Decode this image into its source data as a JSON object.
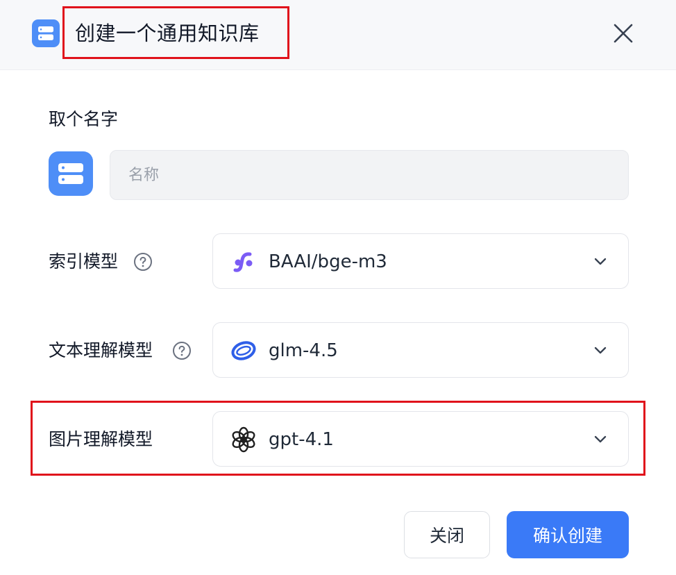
{
  "dialog": {
    "title": "创建一个通用知识库",
    "close_icon": "close-icon",
    "header_icon": "database-icon"
  },
  "name_section": {
    "label": "取个名字",
    "avatar_icon": "database-icon",
    "input_value": "",
    "input_placeholder": "名称"
  },
  "index_model": {
    "label": "索引模型",
    "help_icon": "help-circle-icon",
    "selected": "BAAI/bge-m3",
    "model_icon": "siliconflow-logo-icon",
    "icon_color": "#7b5cf5"
  },
  "text_model": {
    "label": "文本理解模型",
    "help_icon": "help-circle-icon",
    "selected": "glm-4.5",
    "model_icon": "zhipu-logo-icon",
    "icon_color": "#2f5fe8"
  },
  "image_model": {
    "label": "图片理解模型",
    "selected": "gpt-4.1",
    "model_icon": "openai-logo-icon",
    "icon_color": "#1f1f1f"
  },
  "footer": {
    "close_label": "关闭",
    "confirm_label": "确认创建"
  },
  "colors": {
    "accent": "#3a7af7",
    "highlight_border": "#e0121b",
    "icon_bg": "#4e8ef7"
  }
}
